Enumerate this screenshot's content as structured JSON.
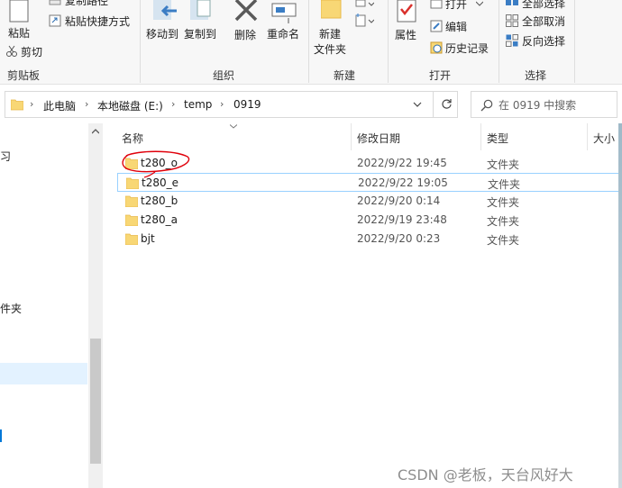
{
  "ribbon": {
    "clipboard": {
      "paste": "粘贴",
      "copy_path": "复制路径",
      "paste_shortcut": "粘贴快捷方式",
      "cut": "剪切",
      "group": "剪贴板"
    },
    "organize": {
      "move_to": "移动到",
      "copy_to": "复制到",
      "delete": "删除",
      "rename": "重命名",
      "group": "组织"
    },
    "new": {
      "new_folder": "新建\n文件夹",
      "new_folder_line1": "新建",
      "new_folder_line2": "文件夹",
      "group": "新建"
    },
    "open": {
      "properties": "属性",
      "open": "打开",
      "edit": "编辑",
      "history": "历史记录",
      "group": "打开"
    },
    "select": {
      "select_all": "全部选择",
      "select_none": "全部取消",
      "invert": "反向选择",
      "group": "选择"
    }
  },
  "address": {
    "crumbs": [
      "此电脑",
      "本地磁盘 (E:)",
      "temp",
      "0919"
    ],
    "search_placeholder": "在 0919 中搜索"
  },
  "nav": {
    "partial_items": [
      "习",
      "件夹"
    ]
  },
  "columns": {
    "name": "名称",
    "date": "修改日期",
    "type": "类型",
    "size": "大小"
  },
  "files": [
    {
      "name": "t280_o",
      "date": "2022/9/22 19:45",
      "type": "文件夹"
    },
    {
      "name": "t280_e",
      "date": "2022/9/22 19:05",
      "type": "文件夹"
    },
    {
      "name": "t280_b",
      "date": "2022/9/20 0:14",
      "type": "文件夹"
    },
    {
      "name": "t280_a",
      "date": "2022/9/19 23:48",
      "type": "文件夹"
    },
    {
      "name": "bjt",
      "date": "2022/9/20 0:23",
      "type": "文件夹"
    }
  ],
  "watermark": "CSDN @老板，天台风好大",
  "colors": {
    "folder": "#f8d775",
    "folder_dark": "#e8b84a",
    "accent": "#0078d7",
    "annotation": "#e0000b"
  }
}
